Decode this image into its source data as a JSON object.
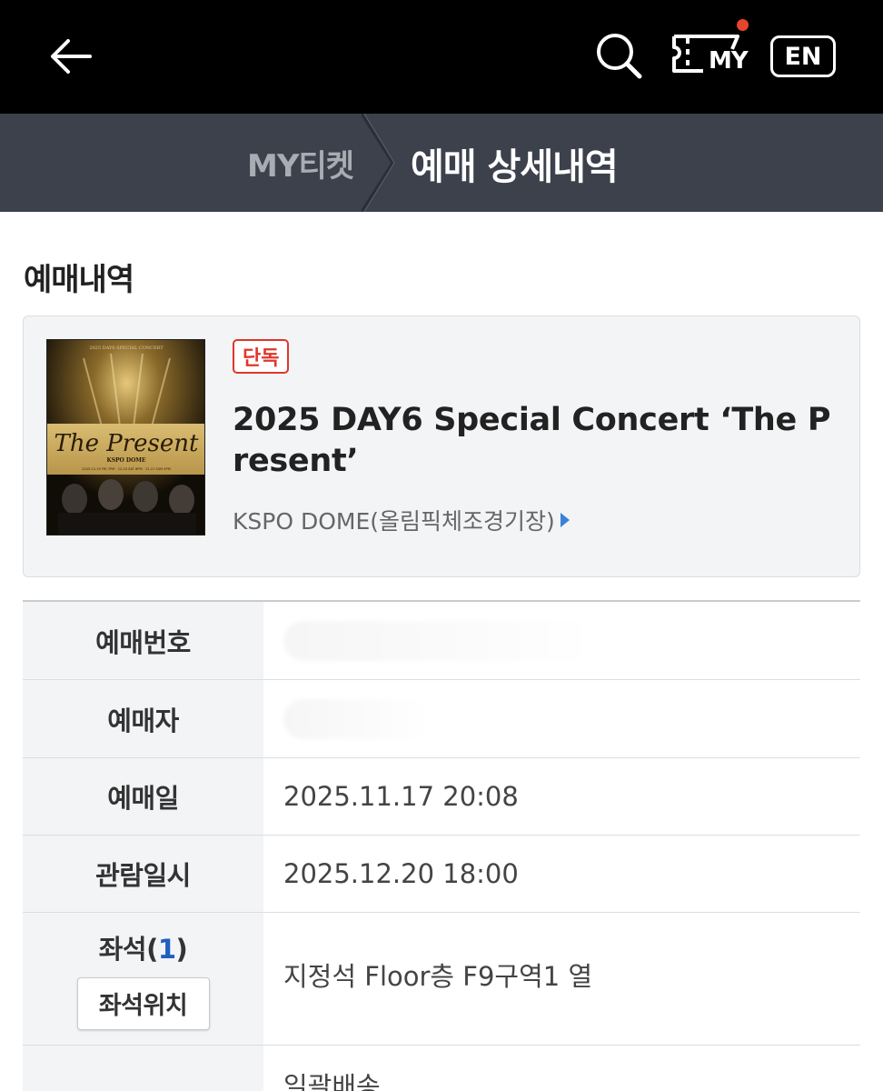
{
  "header": {
    "my_label": "MY",
    "lang_label": "EN"
  },
  "breadcrumb": {
    "parent": "MY티켓",
    "current": "예매 상세내역"
  },
  "section": {
    "title": "예매내역"
  },
  "event": {
    "badge": "단독",
    "title": "2025 DAY6 Special Concert ‘The Present’",
    "venue": "KSPO DOME(올림픽체조경기장)",
    "poster": {
      "top_line": "2025 DAY6 SPECIAL CONCERT",
      "script_title": "The Present",
      "venue": "KSPO DOME",
      "dates": "2025.12.19 FRI 7PM · 12.20 SAT 6PM · 12.21 SUN 5PM"
    }
  },
  "details": {
    "booking_number_label": "예매번호",
    "booker_label": "예매자",
    "booking_date_label": "예매일",
    "booking_date_value": "2025.11.17 20:08",
    "show_datetime_label": "관람일시",
    "show_datetime_value": "2025.12.20 18:00",
    "seat_label": "좌석(",
    "seat_count": "1",
    "seat_label_close": ")",
    "seat_location_button": "좌석위치",
    "seat_value": "지정석 Floor층 F9구역1  열",
    "delivery_value": "일괄배송"
  },
  "colors": {
    "topbar": "#000000",
    "crumbbar": "#3c414c",
    "badge_red": "#e0362b",
    "link_blue": "#3b82d6",
    "notify_dot": "#e8452c"
  },
  "icons": [
    "back-arrow-icon",
    "search-icon",
    "ticket-icon",
    "chevron-right-icon"
  ]
}
